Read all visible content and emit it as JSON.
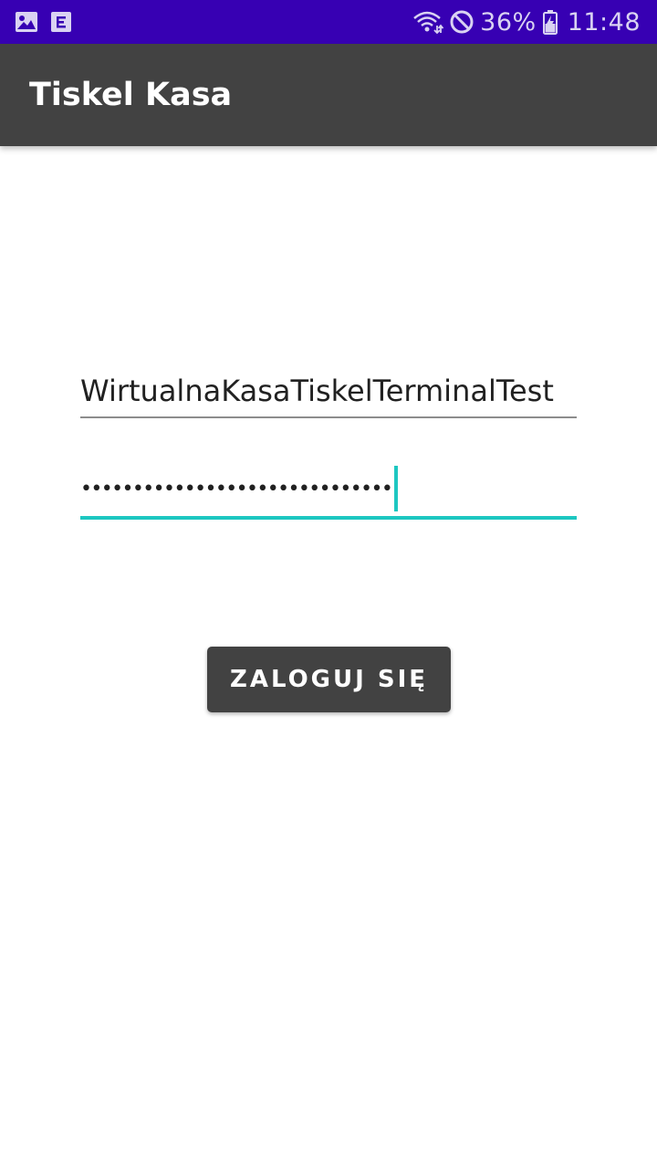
{
  "status_bar": {
    "notification_icons": [
      "image-icon",
      "e-document-icon"
    ],
    "system_icons": [
      "wifi-icon",
      "do-not-disturb-icon",
      "battery-charging-icon"
    ],
    "battery_percent": "36%",
    "time": "11:48",
    "background_color": "#3700b3"
  },
  "app_bar": {
    "title": "Tiskel Kasa",
    "background_color": "#424242"
  },
  "login_form": {
    "username_value": "WirtualnaKasaTiskelTerminalTest",
    "password_masked": "••••••••••••••••••••••••••••••",
    "accent_color": "#1dc7c1",
    "submit_label": "ZALOGUJ SIĘ"
  }
}
